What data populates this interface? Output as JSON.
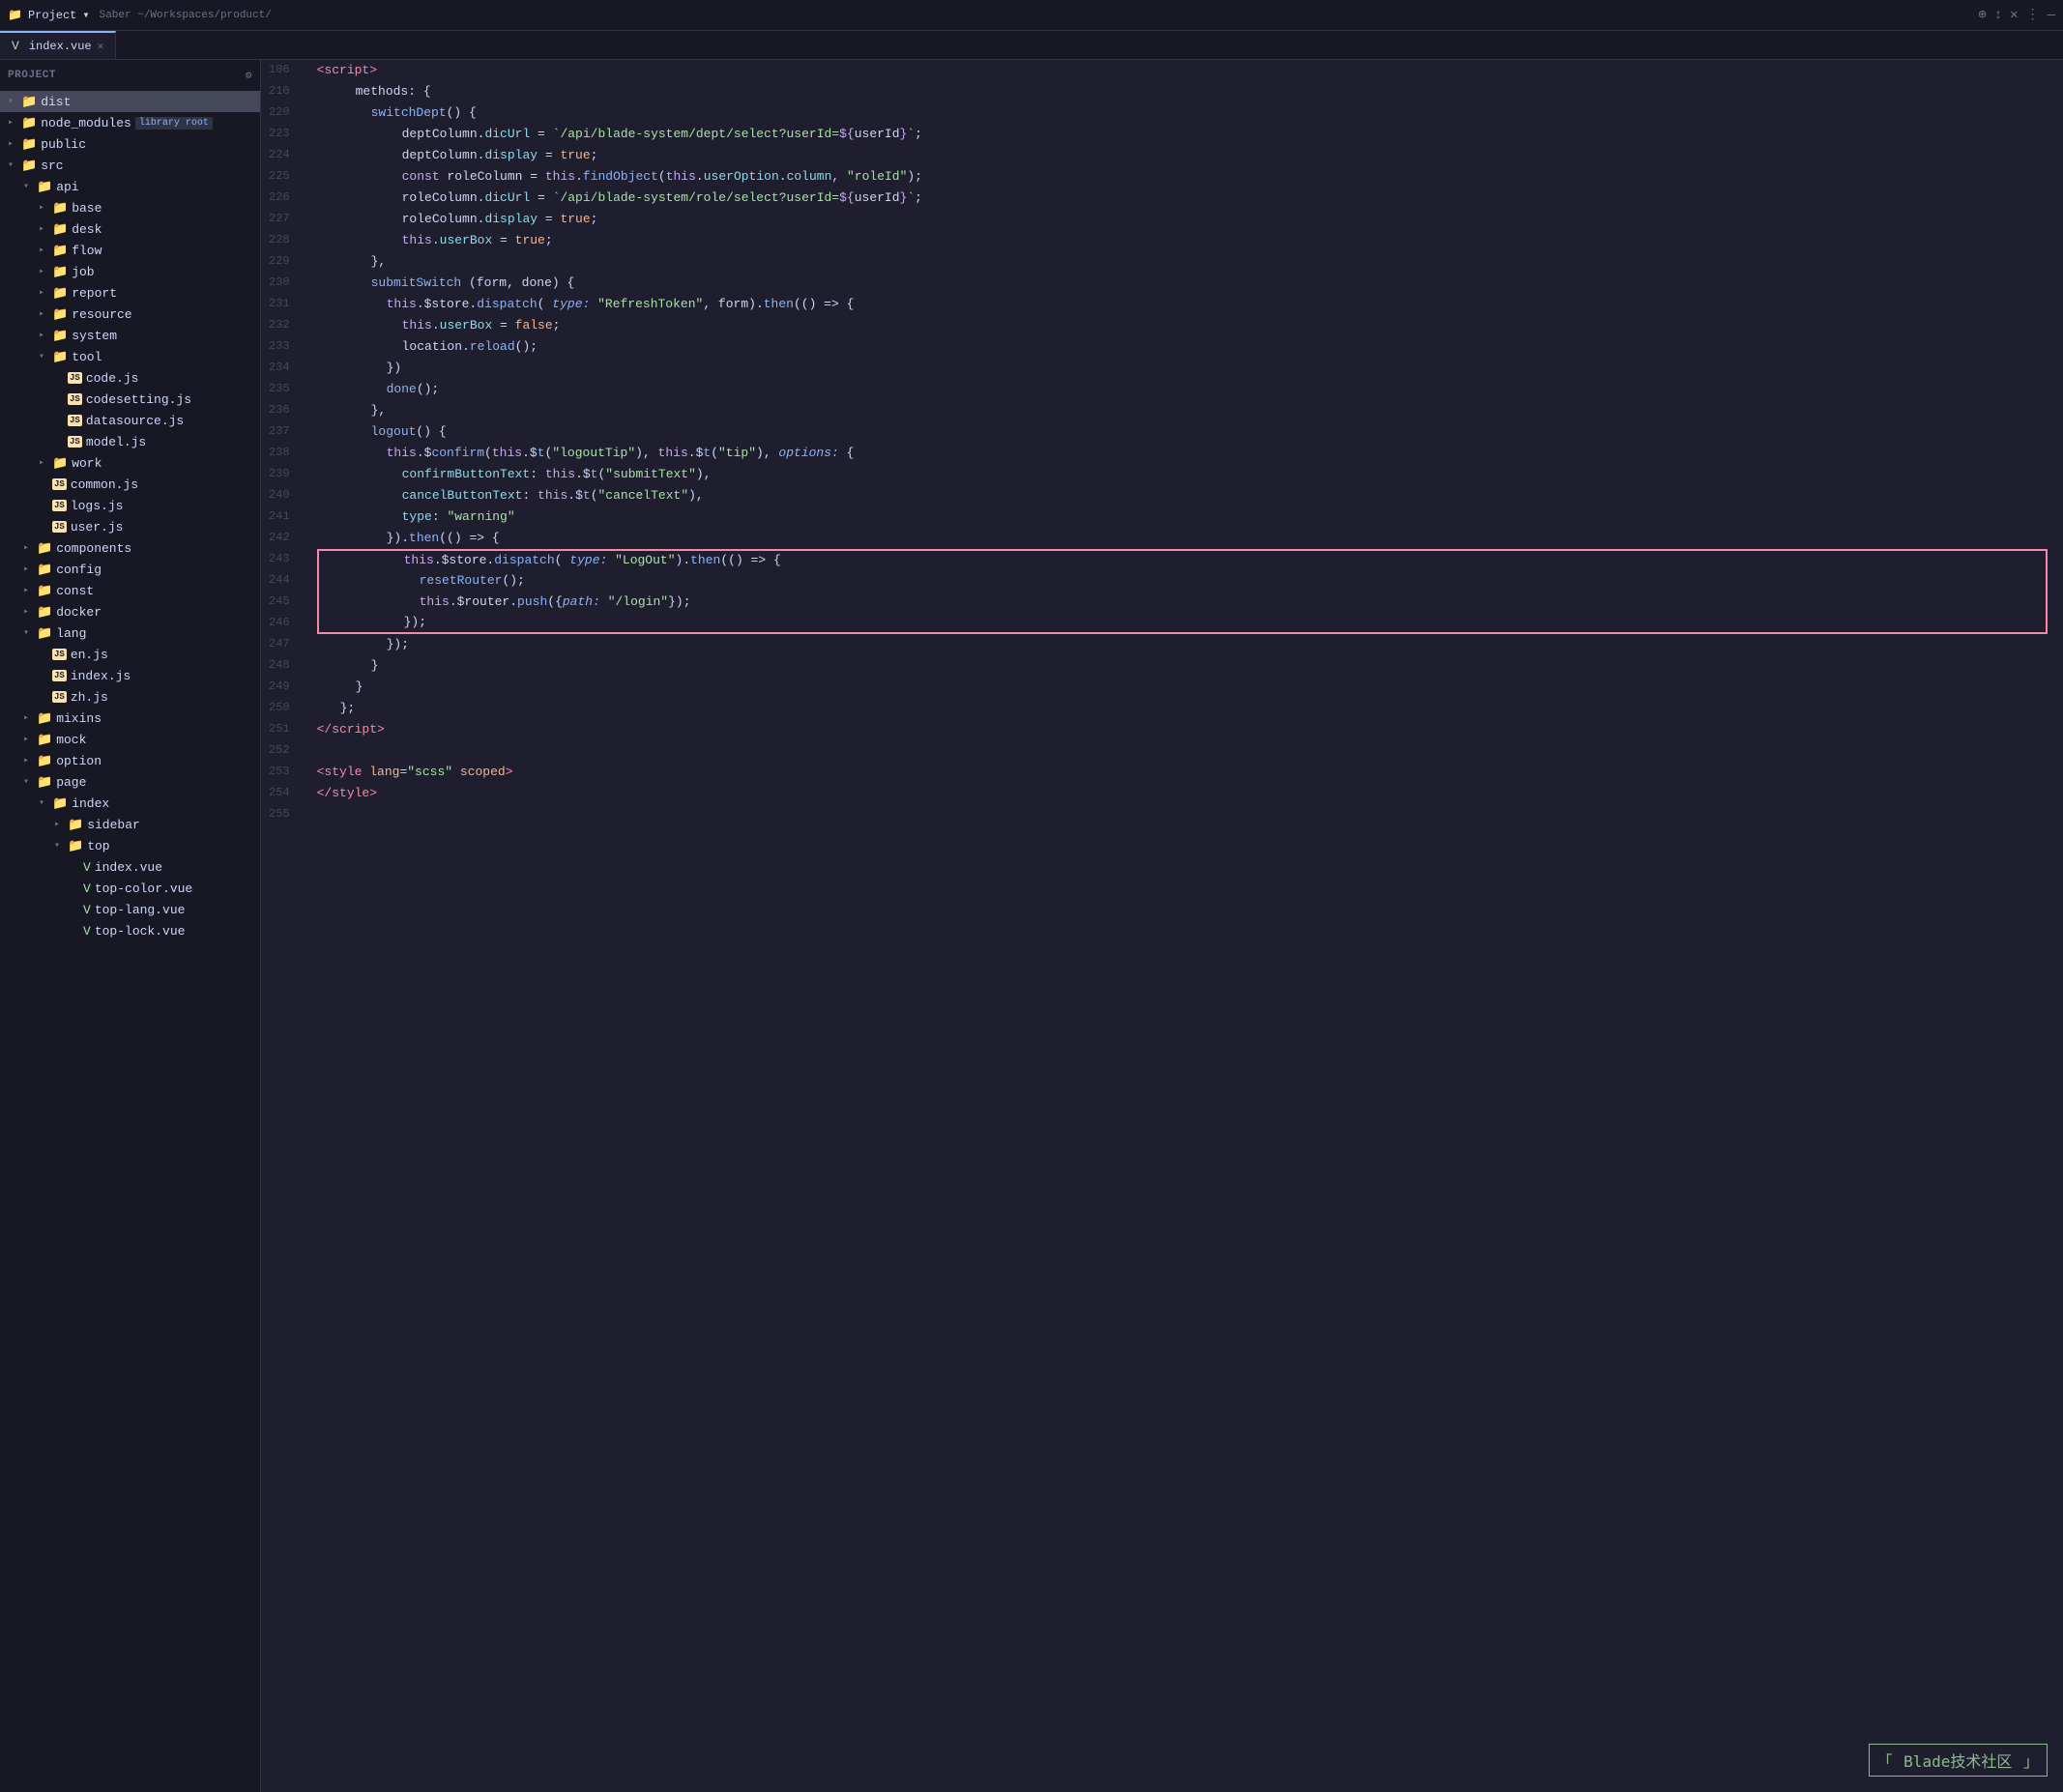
{
  "titleBar": {
    "projectLabel": "Project",
    "projectPath": "Saber ~/Workspaces/product/",
    "chevronIcon": "▾",
    "icons": [
      "⊕",
      "↕",
      "✕",
      "⋮",
      "—"
    ]
  },
  "tabs": [
    {
      "name": "index.vue",
      "active": true,
      "icon": "V",
      "modified": false
    }
  ],
  "sidebar": {
    "header": "Project",
    "tree": [
      {
        "indent": 1,
        "type": "folder",
        "open": true,
        "name": "dist",
        "selected": true
      },
      {
        "indent": 1,
        "type": "folder",
        "open": false,
        "name": "node_modules",
        "badge": "library root"
      },
      {
        "indent": 1,
        "type": "folder",
        "open": false,
        "name": "public"
      },
      {
        "indent": 1,
        "type": "folder",
        "open": true,
        "name": "src"
      },
      {
        "indent": 2,
        "type": "folder",
        "open": true,
        "name": "api"
      },
      {
        "indent": 3,
        "type": "folder",
        "open": false,
        "name": "base"
      },
      {
        "indent": 3,
        "type": "folder",
        "open": false,
        "name": "desk"
      },
      {
        "indent": 3,
        "type": "folder",
        "open": false,
        "name": "flow"
      },
      {
        "indent": 3,
        "type": "folder",
        "open": false,
        "name": "job"
      },
      {
        "indent": 3,
        "type": "folder",
        "open": false,
        "name": "report"
      },
      {
        "indent": 3,
        "type": "folder",
        "open": false,
        "name": "resource"
      },
      {
        "indent": 3,
        "type": "folder",
        "open": false,
        "name": "system"
      },
      {
        "indent": 3,
        "type": "folder",
        "open": true,
        "name": "tool"
      },
      {
        "indent": 4,
        "type": "js",
        "name": "code.js"
      },
      {
        "indent": 4,
        "type": "js",
        "name": "codesetting.js"
      },
      {
        "indent": 4,
        "type": "js",
        "name": "datasource.js"
      },
      {
        "indent": 4,
        "type": "js",
        "name": "model.js"
      },
      {
        "indent": 3,
        "type": "folder",
        "open": false,
        "name": "work"
      },
      {
        "indent": 3,
        "type": "js",
        "name": "common.js"
      },
      {
        "indent": 3,
        "type": "js",
        "name": "logs.js"
      },
      {
        "indent": 3,
        "type": "js",
        "name": "user.js"
      },
      {
        "indent": 2,
        "type": "folder",
        "open": false,
        "name": "components"
      },
      {
        "indent": 2,
        "type": "folder",
        "open": false,
        "name": "config"
      },
      {
        "indent": 2,
        "type": "folder",
        "open": false,
        "name": "const"
      },
      {
        "indent": 2,
        "type": "folder",
        "open": false,
        "name": "docker"
      },
      {
        "indent": 2,
        "type": "folder",
        "open": true,
        "name": "lang"
      },
      {
        "indent": 3,
        "type": "js",
        "name": "en.js"
      },
      {
        "indent": 3,
        "type": "js",
        "name": "index.js"
      },
      {
        "indent": 3,
        "type": "js",
        "name": "zh.js"
      },
      {
        "indent": 2,
        "type": "folder",
        "open": false,
        "name": "mixins"
      },
      {
        "indent": 2,
        "type": "folder",
        "open": false,
        "name": "mock"
      },
      {
        "indent": 2,
        "type": "folder",
        "open": false,
        "name": "option"
      },
      {
        "indent": 2,
        "type": "folder",
        "open": true,
        "name": "page"
      },
      {
        "indent": 3,
        "type": "folder",
        "open": true,
        "name": "index"
      },
      {
        "indent": 4,
        "type": "folder",
        "open": false,
        "name": "sidebar"
      },
      {
        "indent": 4,
        "type": "folder",
        "open": true,
        "name": "top"
      },
      {
        "indent": 5,
        "type": "vue",
        "name": "index.vue"
      },
      {
        "indent": 5,
        "type": "vue",
        "name": "top-color.vue"
      },
      {
        "indent": 5,
        "type": "vue",
        "name": "top-lang.vue"
      },
      {
        "indent": 5,
        "type": "vue",
        "name": "top-lock.vue"
      }
    ]
  },
  "editor": {
    "filename": "index.vue",
    "lines": [
      {
        "num": 106,
        "content": "<script_open>"
      },
      {
        "num": 210,
        "content": "methods_open"
      },
      {
        "num": 220,
        "content": "switchDept_open"
      },
      {
        "num": 223,
        "content": "deptColumn_dicUrl"
      },
      {
        "num": 224,
        "content": "deptColumn_display"
      },
      {
        "num": 225,
        "content": "const_roleColumn"
      },
      {
        "num": 226,
        "content": "roleColumn_dicUrl"
      },
      {
        "num": 227,
        "content": "roleColumn_display"
      },
      {
        "num": 228,
        "content": "this_userBox"
      },
      {
        "num": 229,
        "content": "close_brace_comma"
      },
      {
        "num": 230,
        "content": "submitSwitch"
      },
      {
        "num": 231,
        "content": "store_dispatch_1"
      },
      {
        "num": 232,
        "content": "userBox_false"
      },
      {
        "num": 233,
        "content": "location_reload"
      },
      {
        "num": 234,
        "content": "close_paren"
      },
      {
        "num": 235,
        "content": "done_call"
      },
      {
        "num": 236,
        "content": "close_brace_comma2"
      },
      {
        "num": 237,
        "content": "logout_open"
      },
      {
        "num": 238,
        "content": "this_confirm"
      },
      {
        "num": 239,
        "content": "confirmButtonText"
      },
      {
        "num": 240,
        "content": "cancelButtonText"
      },
      {
        "num": 241,
        "content": "type_warning"
      },
      {
        "num": 242,
        "content": "then_open"
      },
      {
        "num": 243,
        "content": "store_dispatch_2",
        "redBoxTop": true
      },
      {
        "num": 244,
        "content": "resetRouter",
        "redBoxMid": true
      },
      {
        "num": 245,
        "content": "router_push",
        "redBoxMid": true
      },
      {
        "num": 246,
        "content": "close_brace_semi",
        "redBoxBot": true
      },
      {
        "num": 247,
        "content": "close_paren_semi"
      },
      {
        "num": 248,
        "content": "close_brace2"
      },
      {
        "num": 249,
        "content": "close_brace3"
      },
      {
        "num": 250,
        "content": "close_brace_semi2"
      },
      {
        "num": 251,
        "content": "script_close"
      },
      {
        "num": 252,
        "content": "empty"
      },
      {
        "num": 253,
        "content": "style_open"
      },
      {
        "num": 254,
        "content": "style_close"
      },
      {
        "num": 255,
        "content": "empty2"
      }
    ]
  },
  "watermark": {
    "text": "Blade技术社区"
  }
}
